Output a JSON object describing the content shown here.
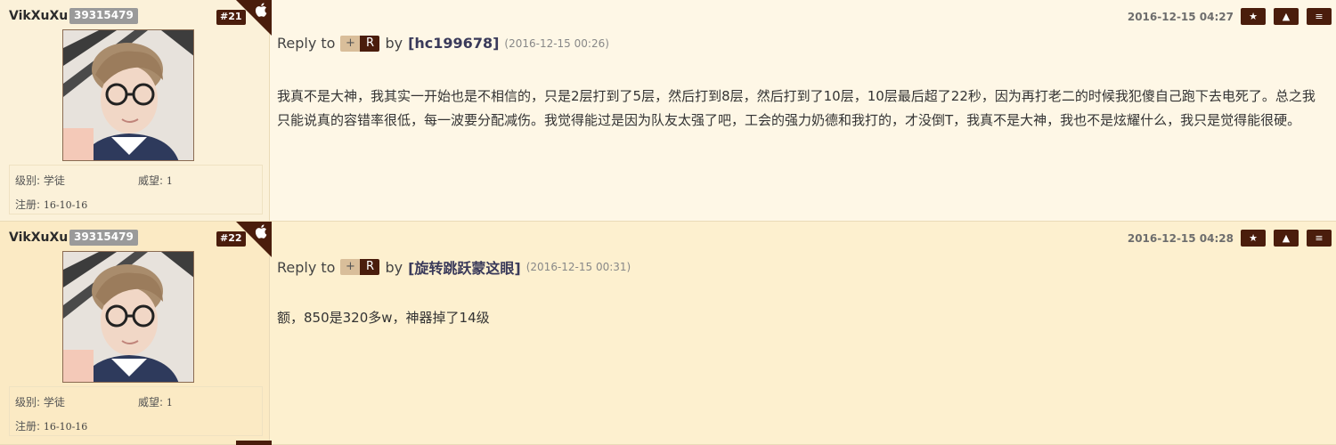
{
  "posts": [
    {
      "username": "VikXuXu",
      "user_id": "39315479",
      "floor": "#21",
      "level_label": "级别:",
      "level_value": "学徒",
      "prestige_label": "威望:",
      "prestige_value": "1",
      "register_label": "注册:",
      "register_value": "16-10-16",
      "timestamp": "2016-12-15 04:27",
      "reply_to": "Reply to",
      "plus": "+",
      "r": "R",
      "by": "by",
      "reply_user": "[hc199678]",
      "reply_time": "(2016-12-15 00:26)",
      "content": "我真不是大神，我其实一开始也是不相信的，只是2层打到了5层，然后打到8层，然后打到了10层，10层最后超了22秒，因为再打老二的时候我犯傻自己跑下去电死了。总之我只能说真的容错率很低，每一波要分配减伤。我觉得能过是因为队友太强了吧，工会的强力奶德和我打的，才没倒T，我真不是大神，我也不是炫耀什么，我只是觉得能很硬。"
    },
    {
      "username": "VikXuXu",
      "user_id": "39315479",
      "floor": "#22",
      "level_label": "级别:",
      "level_value": "学徒",
      "prestige_label": "威望:",
      "prestige_value": "1",
      "register_label": "注册:",
      "register_value": "16-10-16",
      "timestamp": "2016-12-15 04:28",
      "reply_to": "Reply to",
      "plus": "+",
      "r": "R",
      "by": "by",
      "reply_user": "[旋转跳跃蒙这眼]",
      "reply_time": "(2016-12-15 00:31)",
      "content": "额，850是320多w，神器掉了14级"
    }
  ],
  "buttons": {
    "star": "★",
    "up": "▲",
    "menu": "≡"
  },
  "icons": {
    "platform": "apple-icon"
  },
  "colors": {
    "accent": "#4a1d0c",
    "badge_gray": "#9a9a9a",
    "post1_bg": "#fef7e6",
    "post2_bg": "#fdf0cf"
  }
}
